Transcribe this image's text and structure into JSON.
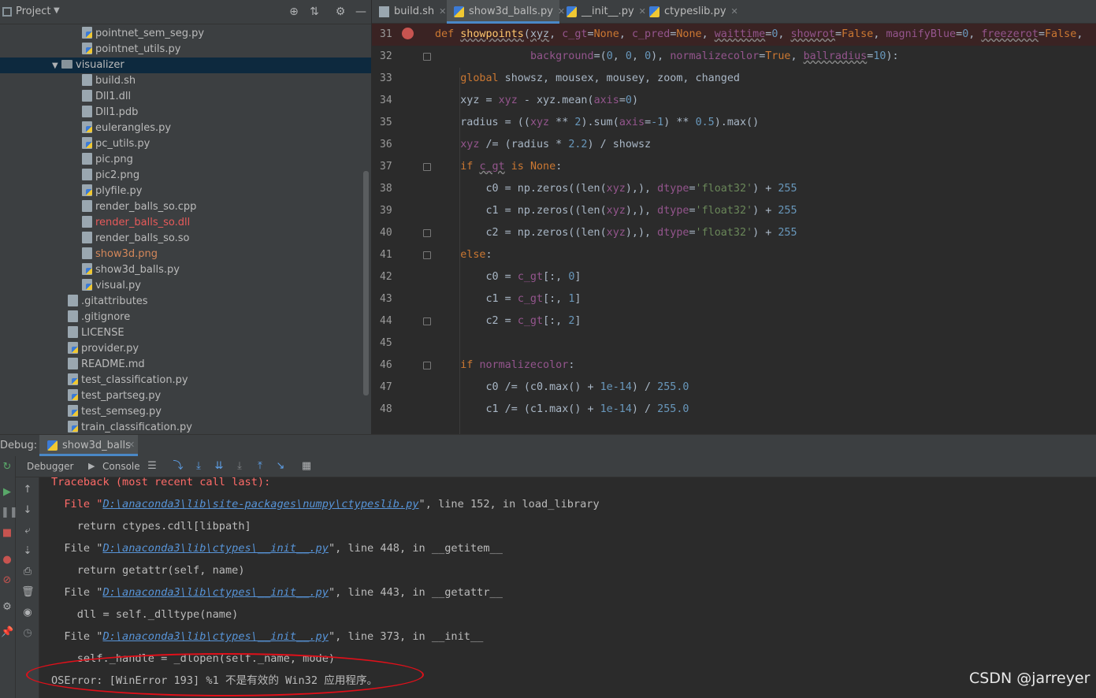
{
  "project": {
    "title": "Project",
    "tree": [
      {
        "label": "pointnet_sem_seg.py",
        "indent": 2,
        "kind": "py",
        "color": "normal"
      },
      {
        "label": "pointnet_utils.py",
        "indent": 2,
        "kind": "py",
        "color": "normal"
      },
      {
        "label": "visualizer",
        "indent": 1,
        "kind": "folder",
        "color": "normal",
        "selected": true
      },
      {
        "label": "build.sh",
        "indent": 2,
        "kind": "file",
        "color": "normal"
      },
      {
        "label": "Dll1.dll",
        "indent": 2,
        "kind": "file",
        "color": "normal"
      },
      {
        "label": "Dll1.pdb",
        "indent": 2,
        "kind": "file",
        "color": "normal"
      },
      {
        "label": "eulerangles.py",
        "indent": 2,
        "kind": "py",
        "color": "normal"
      },
      {
        "label": "pc_utils.py",
        "indent": 2,
        "kind": "py",
        "color": "normal"
      },
      {
        "label": "pic.png",
        "indent": 2,
        "kind": "file",
        "color": "normal"
      },
      {
        "label": "pic2.png",
        "indent": 2,
        "kind": "file",
        "color": "normal"
      },
      {
        "label": "plyfile.py",
        "indent": 2,
        "kind": "py",
        "color": "normal"
      },
      {
        "label": "render_balls_so.cpp",
        "indent": 2,
        "kind": "file",
        "color": "normal"
      },
      {
        "label": "render_balls_so.dll",
        "indent": 2,
        "kind": "file",
        "color": "red"
      },
      {
        "label": "render_balls_so.so",
        "indent": 2,
        "kind": "file",
        "color": "normal"
      },
      {
        "label": "show3d.png",
        "indent": 2,
        "kind": "file",
        "color": "orange"
      },
      {
        "label": "show3d_balls.py",
        "indent": 2,
        "kind": "py",
        "color": "normal"
      },
      {
        "label": "visual.py",
        "indent": 2,
        "kind": "py",
        "color": "normal"
      },
      {
        "label": ".gitattributes",
        "indent": 1,
        "kind": "file",
        "color": "normal"
      },
      {
        "label": ".gitignore",
        "indent": 1,
        "kind": "file",
        "color": "normal"
      },
      {
        "label": "LICENSE",
        "indent": 1,
        "kind": "file",
        "color": "normal"
      },
      {
        "label": "provider.py",
        "indent": 1,
        "kind": "py",
        "color": "normal"
      },
      {
        "label": "README.md",
        "indent": 1,
        "kind": "file",
        "color": "normal"
      },
      {
        "label": "test_classification.py",
        "indent": 1,
        "kind": "py",
        "color": "normal"
      },
      {
        "label": "test_partseg.py",
        "indent": 1,
        "kind": "py",
        "color": "normal"
      },
      {
        "label": "test_semseg.py",
        "indent": 1,
        "kind": "py",
        "color": "normal"
      },
      {
        "label": "train_classification.py",
        "indent": 1,
        "kind": "py",
        "color": "normal"
      }
    ]
  },
  "tabs": [
    {
      "label": "build.sh",
      "active": false
    },
    {
      "label": "show3d_balls.py",
      "active": true
    },
    {
      "label": "__init__.py",
      "active": false
    },
    {
      "label": "ctypeslib.py",
      "active": false
    }
  ],
  "code": [
    {
      "n": "31",
      "html": "<span class='kw'>def</span> <span class='fn ul'>showpoints</span>(<span class='ul'>xyz</span>, <span class='param'>c_gt</span>=<span class='kw'>None</span>, <span class='param'>c_pred</span>=<span class='kw'>None</span>, <span class='param ul'>waittime</span>=<span class='num'>0</span>, <span class='param ul'>showrot</span>=<span class='kw'>False</span>, <span class='param'>magnifyBlue</span>=<span class='num'>0</span>, <span class='param ul'>freezerot</span>=<span class='kw'>False</span>,"
    },
    {
      "n": "32",
      "html": "               <span class='param'>background</span>=(<span class='num'>0</span>, <span class='num'>0</span>, <span class='num'>0</span>), <span class='param'>normalizecolor</span>=<span class='kw'>True</span>, <span class='param ul'>ballradius</span>=<span class='num'>10</span>):"
    },
    {
      "n": "33",
      "html": "    <span class='kw'>global</span> showsz, mousex, mousey, zoom, changed"
    },
    {
      "n": "34",
      "html": "    xyz = <span class='param'>xyz</span> - xyz.mean(<span class='param'>axis</span>=<span class='num'>0</span>)"
    },
    {
      "n": "35",
      "html": "    radius = ((<span class='param'>xyz</span> ** <span class='num'>2</span>).sum(<span class='param'>axis</span>=<span class='num'>-1</span>) ** <span class='num'>0.5</span>).max()"
    },
    {
      "n": "36",
      "html": "    <span class='param'>xyz</span> /= (radius * <span class='num'>2.2</span>) / showsz"
    },
    {
      "n": "37",
      "html": "    <span class='kw'>if</span> <span class='param ul'>c_gt</span> <span class='kw'>is</span> <span class='kw'>None</span>:"
    },
    {
      "n": "38",
      "html": "        c0 = np.zeros((len(<span class='param'>xyz</span>),), <span class='param'>dtype</span>=<span class='str'>'float32'</span>) + <span class='num'>255</span>"
    },
    {
      "n": "39",
      "html": "        c1 = np.zeros((len(<span class='param'>xyz</span>),), <span class='param'>dtype</span>=<span class='str'>'float32'</span>) + <span class='num'>255</span>"
    },
    {
      "n": "40",
      "html": "        c2 = np.zeros((len(<span class='param'>xyz</span>),), <span class='param'>dtype</span>=<span class='str'>'float32'</span>) + <span class='num'>255</span>"
    },
    {
      "n": "41",
      "html": "    <span class='kw'>else</span>:"
    },
    {
      "n": "42",
      "html": "        c0 = <span class='param'>c_gt</span>[:, <span class='num'>0</span>]"
    },
    {
      "n": "43",
      "html": "        c1 = <span class='param'>c_gt</span>[:, <span class='num'>1</span>]"
    },
    {
      "n": "44",
      "html": "        c2 = <span class='param'>c_gt</span>[:, <span class='num'>2</span>]"
    },
    {
      "n": "45",
      "html": ""
    },
    {
      "n": "46",
      "html": "    <span class='kw'>if</span> <span class='param'>normalizecolor</span>:"
    },
    {
      "n": "47",
      "html": "        c0 /= (c0.max() + <span class='num'>1e-14</span>) / <span class='num'>255.0</span>"
    },
    {
      "n": "48",
      "html": "        c1 /= (c1.max() + <span class='num'>1e-14</span>) / <span class='num'>255.0</span>"
    }
  ],
  "debug": {
    "label": "Debug:",
    "session": "show3d_balls",
    "debugger_tab": "Debugger",
    "console_tab": "Console"
  },
  "console": [
    {
      "parts": [
        {
          "t": "Traceback (most recent call last):",
          "c": "errtxt"
        }
      ]
    },
    {
      "parts": [
        {
          "t": "  File \"",
          "c": "errtxt"
        },
        {
          "t": "D:\\anaconda3\\lib\\site-packages\\numpy\\ctypeslib.py",
          "c": "link"
        },
        {
          "t": "\", line 152, in load_library",
          "c": ""
        }
      ]
    },
    {
      "parts": [
        {
          "t": "    return ctypes.cdll[libpath]",
          "c": ""
        }
      ]
    },
    {
      "parts": [
        {
          "t": "  File \"",
          "c": ""
        },
        {
          "t": "D:\\anaconda3\\lib\\ctypes\\__init__.py",
          "c": "link"
        },
        {
          "t": "\", line 448, in __getitem__",
          "c": ""
        }
      ]
    },
    {
      "parts": [
        {
          "t": "    return getattr(self, name)",
          "c": ""
        }
      ]
    },
    {
      "parts": [
        {
          "t": "  File \"",
          "c": ""
        },
        {
          "t": "D:\\anaconda3\\lib\\ctypes\\__init__.py",
          "c": "link"
        },
        {
          "t": "\", line 443, in __getattr__",
          "c": ""
        }
      ]
    },
    {
      "parts": [
        {
          "t": "    dll = self._dlltype(name)",
          "c": ""
        }
      ]
    },
    {
      "parts": [
        {
          "t": "  File \"",
          "c": ""
        },
        {
          "t": "D:\\anaconda3\\lib\\ctypes\\__init__.py",
          "c": "link"
        },
        {
          "t": "\", line 373, in __init__",
          "c": ""
        }
      ]
    },
    {
      "parts": [
        {
          "t": "    self._handle = _dlopen(self._name, mode)",
          "c": ""
        }
      ]
    },
    {
      "parts": [
        {
          "t": "OSError: [WinError 193] %1 不是有效的 Win32 应用程序。",
          "c": ""
        }
      ]
    }
  ],
  "watermark": "CSDN @jarreyer"
}
